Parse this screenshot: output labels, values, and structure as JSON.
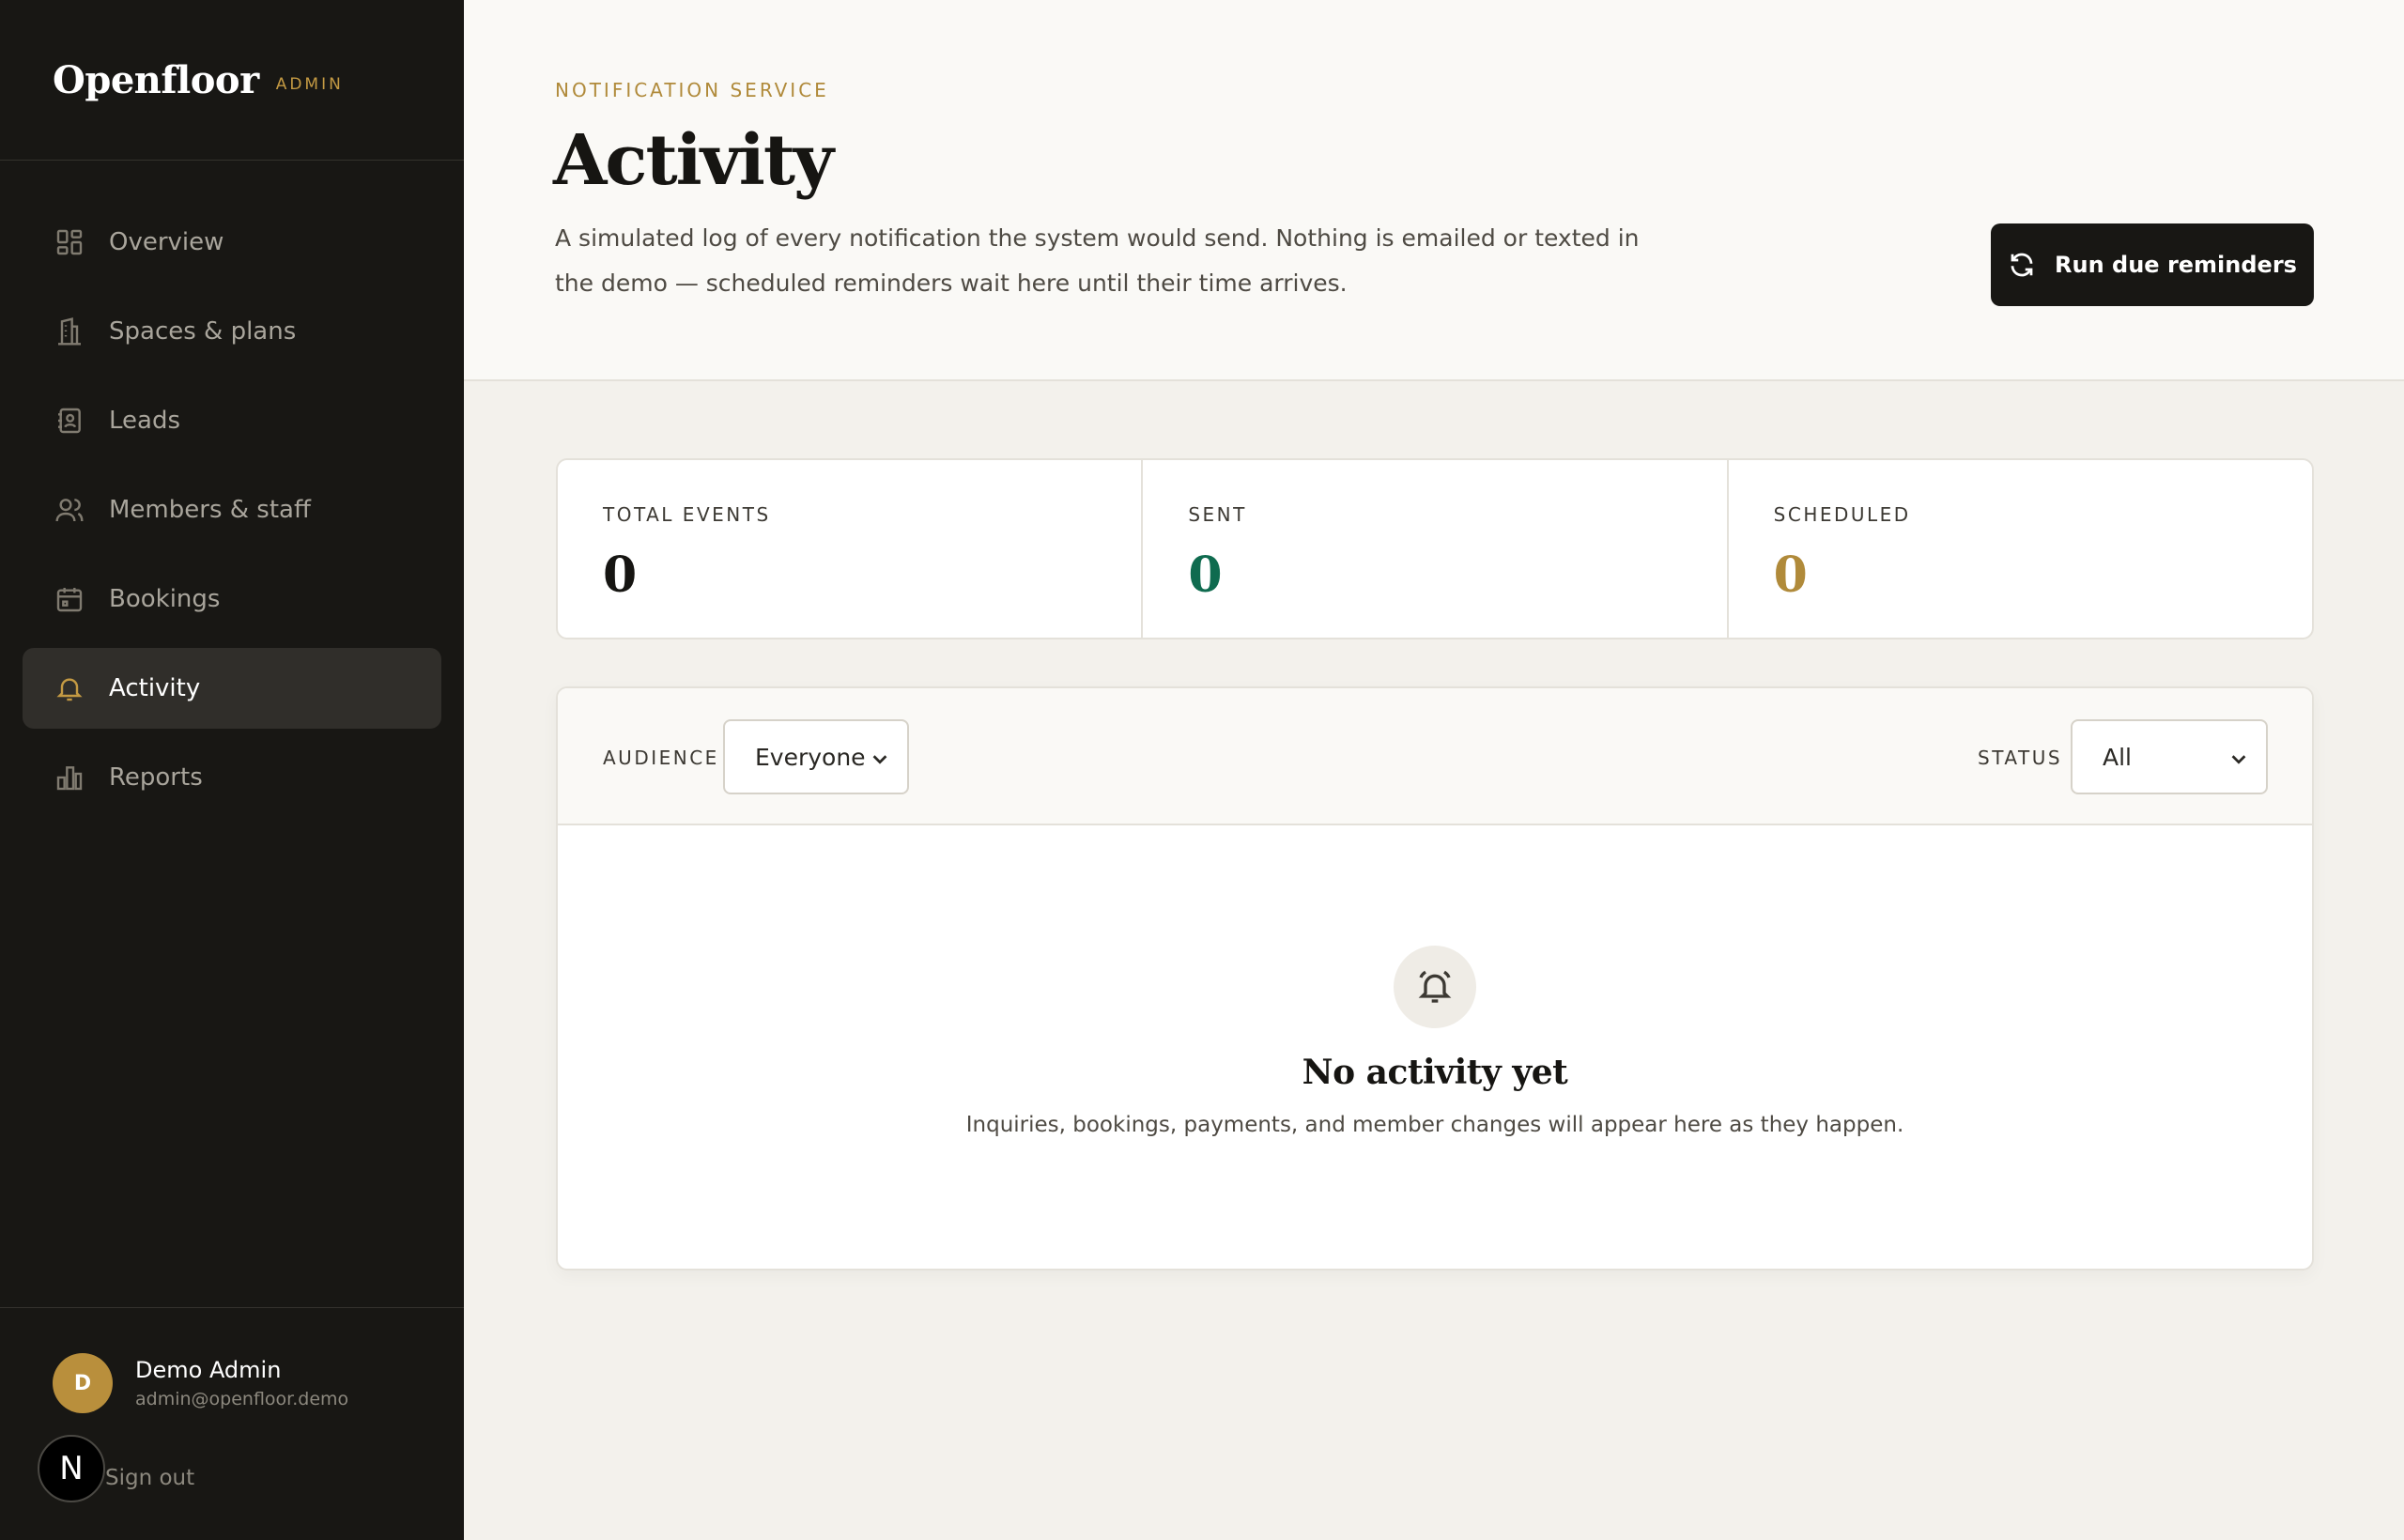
{
  "sidebar": {
    "brand": {
      "name": "Openfloor",
      "tag": "ADMIN"
    },
    "items": [
      {
        "label": "Overview",
        "icon": "layout-grid-icon"
      },
      {
        "label": "Spaces & plans",
        "icon": "building-icon"
      },
      {
        "label": "Leads",
        "icon": "contact-book-icon"
      },
      {
        "label": "Members & staff",
        "icon": "users-icon"
      },
      {
        "label": "Bookings",
        "icon": "calendar-icon"
      },
      {
        "label": "Activity",
        "icon": "bell-icon",
        "active": true
      },
      {
        "label": "Reports",
        "icon": "bar-chart-icon"
      }
    ],
    "user": {
      "initial": "D",
      "name": "Demo Admin",
      "email": "admin@openfloor.demo"
    },
    "signout_label": "Sign out",
    "badge_letter": "N"
  },
  "header": {
    "eyebrow": "NOTIFICATION SERVICE",
    "title": "Activity",
    "description": "A simulated log of every notification the system would send. Nothing is emailed or texted in the demo — scheduled reminders wait here until their time arrives.",
    "run_button_label": "Run due reminders"
  },
  "stats": [
    {
      "label": "TOTAL EVENTS",
      "value": "0",
      "color": "#161512"
    },
    {
      "label": "SENT",
      "value": "0",
      "color": "#0f6b4f"
    },
    {
      "label": "SCHEDULED",
      "value": "0",
      "color": "#b08a3a"
    }
  ],
  "filters": {
    "audience": {
      "label": "AUDIENCE",
      "value": "Everyone"
    },
    "status": {
      "label": "STATUS",
      "value": "All"
    }
  },
  "empty_state": {
    "title": "No activity yet",
    "text": "Inquiries, bookings, payments, and member changes will appear here as they happen."
  },
  "colors": {
    "sidebar_bg": "#181714",
    "accent_gold": "#c49a43",
    "sent_green": "#0f6b4f",
    "page_bg": "#f3f1ec"
  }
}
